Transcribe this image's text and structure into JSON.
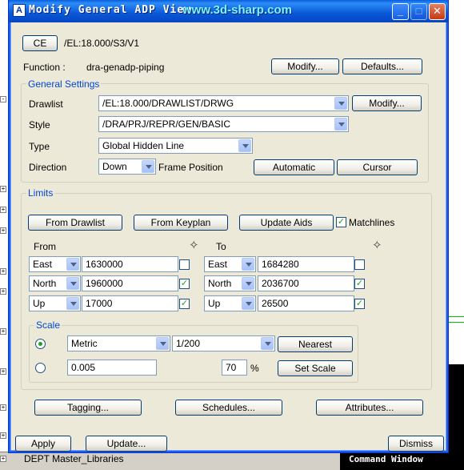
{
  "window": {
    "title": "Modify General ADP View",
    "watermark": "www.3d-sharp.com"
  },
  "header": {
    "ce_label": "CE",
    "ce_path": "/EL:18.000/S3/V1",
    "function_label": "Function :",
    "function_value": "dra-genadp-piping",
    "modify_label": "Modify...",
    "defaults_label": "Defaults..."
  },
  "general": {
    "title": "General Settings",
    "drawlist_label": "Drawlist",
    "drawlist_value": "/EL:18.000/DRAWLIST/DRWG",
    "drawlist_modify": "Modify...",
    "style_label": "Style",
    "style_value": "/DRA/PRJ/REPR/GEN/BASIC",
    "type_label": "Type",
    "type_value": "Global Hidden Line",
    "direction_label": "Direction",
    "direction_value": "Down",
    "frame_position_label": "Frame Position",
    "automatic_label": "Automatic",
    "cursor_label": "Cursor"
  },
  "limits": {
    "title": "Limits",
    "from_drawlist": "From Drawlist",
    "from_keyplan": "From Keyplan",
    "update_aids": "Update Aids",
    "matchlines_label": "Matchlines",
    "matchlines_checked": true,
    "from_label": "From",
    "to_label": "To",
    "from": [
      {
        "axis": "East",
        "value": "1630000",
        "checked": false
      },
      {
        "axis": "North",
        "value": "1960000",
        "checked": true
      },
      {
        "axis": "Up",
        "value": "17000",
        "checked": true
      }
    ],
    "to": [
      {
        "axis": "East",
        "value": "1684280",
        "checked": false
      },
      {
        "axis": "North",
        "value": "2036700",
        "checked": true
      },
      {
        "axis": "Up",
        "value": "26500",
        "checked": true
      }
    ]
  },
  "scale": {
    "title": "Scale",
    "unit_value": "Metric",
    "ratio_value": "1/200",
    "nearest_label": "Nearest",
    "custom_value": "0.005",
    "percent_value": "70",
    "percent_sign": "%",
    "set_scale_label": "Set Scale",
    "mode_selected": "preset"
  },
  "bottom": {
    "tagging": "Tagging...",
    "schedules": "Schedules...",
    "attributes": "Attributes...",
    "apply": "Apply",
    "update": "Update...",
    "dismiss": "Dismiss"
  },
  "background": {
    "tree_item": "DEPT Master_Libraries",
    "command_window": "Command Window"
  },
  "colors": {
    "title_bar": "#0a58d8",
    "group_title": "#0046d5",
    "check": "#21a121",
    "dialog_bg": "#ece9d8"
  }
}
